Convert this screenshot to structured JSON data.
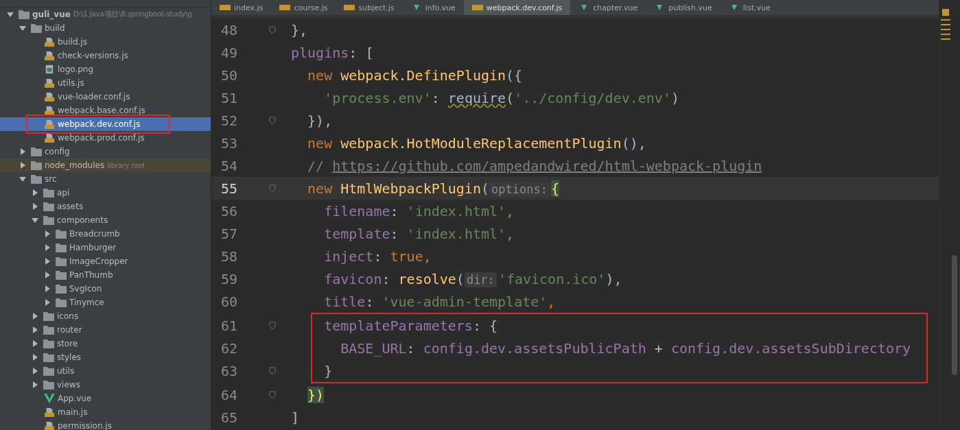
{
  "tabs": [
    {
      "label": "index.js",
      "kind": "js",
      "selected": false
    },
    {
      "label": "course.js",
      "kind": "js",
      "selected": false
    },
    {
      "label": "subject.js",
      "kind": "js",
      "selected": false
    },
    {
      "label": "info.vue",
      "kind": "vue",
      "selected": false
    },
    {
      "label": "webpack.dev.conf.js",
      "kind": "js",
      "selected": true
    },
    {
      "label": "chapter.vue",
      "kind": "vue",
      "selected": false
    },
    {
      "label": "publish.vue",
      "kind": "vue",
      "selected": false
    },
    {
      "label": "list.vue",
      "kind": "vue",
      "selected": false
    }
  ],
  "tree": [
    {
      "name": "guli_vue",
      "note": "D:\\1 Java项目\\8.springboot-study\\g",
      "kind": "folder",
      "expanded": true,
      "selected": false,
      "children": [
        {
          "name": "build",
          "kind": "folder",
          "expanded": true,
          "selected": false,
          "children": [
            {
              "name": "build.js",
              "kind": "js",
              "selected": false
            },
            {
              "name": "check-versions.js",
              "kind": "js",
              "selected": false
            },
            {
              "name": "logo.png",
              "kind": "image",
              "selected": false
            },
            {
              "name": "utils.js",
              "kind": "js",
              "selected": false
            },
            {
              "name": "vue-loader.conf.js",
              "kind": "js",
              "selected": false
            },
            {
              "name": "webpack.base.conf.js",
              "kind": "js",
              "selected": false
            },
            {
              "name": "webpack.dev.conf.js",
              "kind": "js",
              "selected": true,
              "annotated": true
            },
            {
              "name": "webpack.prod.conf.js",
              "kind": "js",
              "selected": false
            }
          ]
        },
        {
          "name": "config",
          "kind": "folder",
          "expanded": false,
          "selected": false
        },
        {
          "name": "node_modules",
          "note": "library root",
          "kind": "folder",
          "expanded": false,
          "selected": false,
          "excluded": true
        },
        {
          "name": "src",
          "kind": "folder",
          "expanded": true,
          "selected": false,
          "children": [
            {
              "name": "api",
              "kind": "folder",
              "expanded": false,
              "selected": false
            },
            {
              "name": "assets",
              "kind": "folder",
              "expanded": false,
              "selected": false
            },
            {
              "name": "components",
              "kind": "folder",
              "expanded": true,
              "selected": false,
              "children": [
                {
                  "name": "Breadcrumb",
                  "kind": "folder",
                  "expanded": false,
                  "selected": false
                },
                {
                  "name": "Hamburger",
                  "kind": "folder",
                  "expanded": false,
                  "selected": false
                },
                {
                  "name": "ImageCropper",
                  "kind": "folder",
                  "expanded": false,
                  "selected": false
                },
                {
                  "name": "PanThumb",
                  "kind": "folder",
                  "expanded": false,
                  "selected": false
                },
                {
                  "name": "SvgIcon",
                  "kind": "folder",
                  "expanded": false,
                  "selected": false
                },
                {
                  "name": "Tinymce",
                  "kind": "folder",
                  "expanded": false,
                  "selected": false
                }
              ]
            },
            {
              "name": "icons",
              "kind": "folder",
              "expanded": false,
              "selected": false
            },
            {
              "name": "router",
              "kind": "folder",
              "expanded": false,
              "selected": false
            },
            {
              "name": "store",
              "kind": "folder",
              "expanded": false,
              "selected": false
            },
            {
              "name": "styles",
              "kind": "folder",
              "expanded": false,
              "selected": false
            },
            {
              "name": "utils",
              "kind": "folder",
              "expanded": false,
              "selected": false
            },
            {
              "name": "views",
              "kind": "folder",
              "expanded": false,
              "selected": false
            },
            {
              "name": "App.vue",
              "kind": "vue",
              "selected": false
            },
            {
              "name": "main.js",
              "kind": "js",
              "selected": false
            },
            {
              "name": "permission.js",
              "kind": "js",
              "selected": false
            }
          ]
        }
      ]
    }
  ],
  "code": [
    {
      "number": "48",
      "fold": true,
      "tokens": [
        {
          "t": "},",
          "kind": "plain"
        }
      ]
    },
    {
      "number": "49",
      "tokens": [
        {
          "t": "plugins",
          "kind": "prop"
        },
        {
          "t": ": [",
          "kind": "plain"
        }
      ]
    },
    {
      "number": "50",
      "tokens": [
        {
          "t": "  new ",
          "kind": "kw"
        },
        {
          "t": "webpack.DefinePlugin",
          "kind": "fn"
        },
        {
          "t": "({",
          "kind": "plain"
        }
      ]
    },
    {
      "number": "51",
      "tokens": [
        {
          "t": "    'process.env'",
          "kind": "str"
        },
        {
          "t": ": ",
          "kind": "plain"
        },
        {
          "t": "require",
          "kind": "warn"
        },
        {
          "t": "(",
          "kind": "plain"
        },
        {
          "t": "'../config/dev.env'",
          "kind": "str"
        },
        {
          "t": ")",
          "kind": "plain"
        }
      ]
    },
    {
      "number": "52",
      "fold": true,
      "tokens": [
        {
          "t": "  }),",
          "kind": "plain"
        }
      ]
    },
    {
      "number": "53",
      "tokens": [
        {
          "t": "  new ",
          "kind": "kw"
        },
        {
          "t": "webpack.HotModuleReplacementPlugin",
          "kind": "fn"
        },
        {
          "t": "(),",
          "kind": "plain"
        }
      ]
    },
    {
      "number": "54",
      "tokens": [
        {
          "t": "  // ",
          "kind": "comment"
        },
        {
          "t": "https://github.com/ampedandwired/html-webpack-plugin",
          "kind": "link"
        }
      ]
    },
    {
      "number": "55",
      "fold": true,
      "current": true,
      "tokens": [
        {
          "t": "  new ",
          "kind": "kw"
        },
        {
          "t": "HtmlWebpackPlugin",
          "kind": "fn"
        },
        {
          "t": "(",
          "kind": "plain"
        },
        {
          "t": "options:",
          "kind": "hint"
        },
        {
          "t": "{",
          "kind": "brace0"
        }
      ]
    },
    {
      "number": "56",
      "tokens": [
        {
          "t": "    filename",
          "kind": "prop"
        },
        {
          "t": ": ",
          "kind": "plain"
        },
        {
          "t": "'index.html'",
          "kind": "str"
        },
        {
          "t": ",",
          "kind": "kw"
        }
      ]
    },
    {
      "number": "57",
      "tokens": [
        {
          "t": "    template",
          "kind": "prop"
        },
        {
          "t": ": ",
          "kind": "plain"
        },
        {
          "t": "'index.html'",
          "kind": "str"
        },
        {
          "t": ",",
          "kind": "kw"
        }
      ]
    },
    {
      "number": "58",
      "tokens": [
        {
          "t": "    inject",
          "kind": "prop"
        },
        {
          "t": ": ",
          "kind": "plain"
        },
        {
          "t": "true",
          "kind": "kw"
        },
        {
          "t": ",",
          "kind": "kw"
        }
      ]
    },
    {
      "number": "59",
      "tokens": [
        {
          "t": "    favicon",
          "kind": "prop"
        },
        {
          "t": ": ",
          "kind": "plain"
        },
        {
          "t": "resolve",
          "kind": "fn"
        },
        {
          "t": "(",
          "kind": "plain"
        },
        {
          "t": "dir:",
          "kind": "hint"
        },
        {
          "t": "'favicon.ico'",
          "kind": "str"
        },
        {
          "t": "),",
          "kind": "plain"
        }
      ]
    },
    {
      "number": "60",
      "tokens": [
        {
          "t": "    title",
          "kind": "prop"
        },
        {
          "t": ": ",
          "kind": "plain"
        },
        {
          "t": "'vue-admin-template'",
          "kind": "str"
        },
        {
          "t": ",",
          "kind": "kw"
        }
      ]
    },
    {
      "number": "61",
      "fold": true,
      "boxed": true,
      "tokens": [
        {
          "t": "    templateParameters",
          "kind": "prop"
        },
        {
          "t": ": {",
          "kind": "plain"
        }
      ]
    },
    {
      "number": "62",
      "boxed": true,
      "tokens": [
        {
          "t": "      BASE_URL",
          "kind": "prop"
        },
        {
          "t": ": ",
          "kind": "plain"
        },
        {
          "t": "config.dev.assetsPublicPath",
          "kind": "prop"
        },
        {
          "t": " + ",
          "kind": "plain"
        },
        {
          "t": "config.dev.assetsSubDirectory",
          "kind": "prop"
        }
      ]
    },
    {
      "number": "63",
      "fold": true,
      "boxed": true,
      "tokens": [
        {
          "t": "    }",
          "kind": "plain"
        }
      ]
    },
    {
      "number": "64",
      "fold": true,
      "tokens": [
        {
          "t": "  })",
          "kind": "brace"
        }
      ]
    },
    {
      "number": "65",
      "tokens": [
        {
          "t": "]",
          "kind": "plain"
        }
      ]
    }
  ]
}
